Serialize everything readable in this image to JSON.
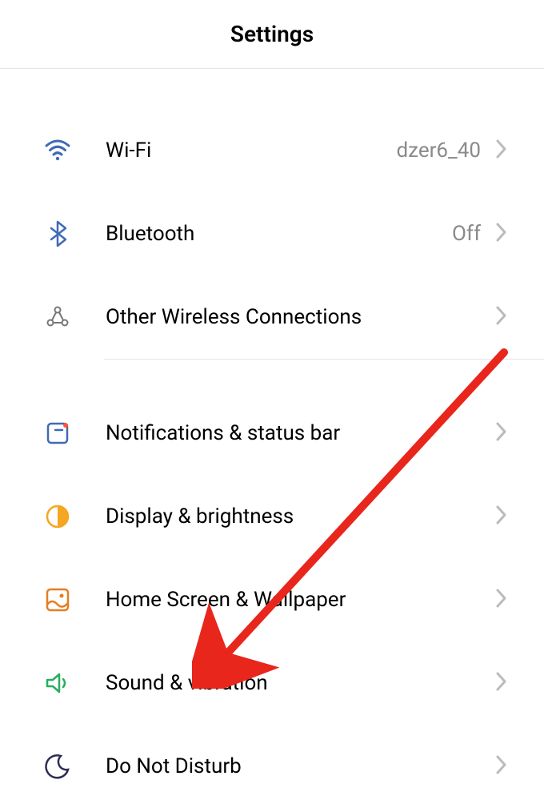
{
  "header": {
    "title": "Settings"
  },
  "sections": [
    {
      "items": [
        {
          "id": "wifi",
          "label": "Wi-Fi",
          "value": "dzer6_40"
        },
        {
          "id": "bluetooth",
          "label": "Bluetooth",
          "value": "Off"
        },
        {
          "id": "other-wireless",
          "label": "Other Wireless Connections",
          "value": ""
        }
      ]
    },
    {
      "items": [
        {
          "id": "notifications",
          "label": "Notifications & status bar",
          "value": ""
        },
        {
          "id": "display",
          "label": "Display & brightness",
          "value": ""
        },
        {
          "id": "home-screen",
          "label": "Home Screen & Wallpaper",
          "value": ""
        },
        {
          "id": "sound",
          "label": "Sound & vibration",
          "value": ""
        },
        {
          "id": "dnd",
          "label": "Do Not Disturb",
          "value": ""
        }
      ]
    }
  ]
}
